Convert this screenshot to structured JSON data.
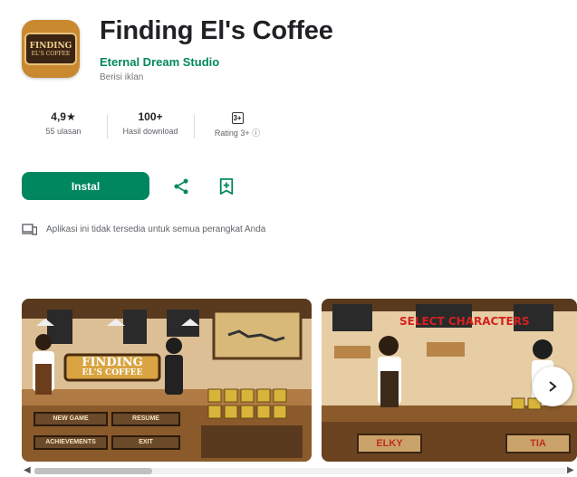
{
  "app": {
    "title": "Finding El's Coffee",
    "developer": "Eternal Dream Studio",
    "purchases": "Berisi iklan",
    "icon_line1": "FINDING",
    "icon_line2": "EL'S COFFEE"
  },
  "stats": [
    {
      "value": "4,9★",
      "label": "55 ulasan"
    },
    {
      "value": "100+",
      "label": "Hasil download"
    },
    {
      "value": "3+",
      "label": "Rating 3+ ⓘ"
    }
  ],
  "actions": {
    "install_label": "Instal"
  },
  "notice": "Aplikasi ini tidak tersedia untuk semua perangkat Anda",
  "screenshots": [
    {
      "logo_line1": "FINDING",
      "logo_line2": "EL'S COFFEE",
      "menu": [
        "NEW GAME",
        "RESUME",
        "ACHIEVEMENTS",
        "EXIT"
      ]
    },
    {
      "heading": "SELECT CHARACTERS",
      "names": [
        "ELKY",
        "TIA"
      ]
    }
  ],
  "colors": {
    "accent": "#01875f",
    "wood": "#8a5a2b",
    "gold": "#e8c07a"
  }
}
